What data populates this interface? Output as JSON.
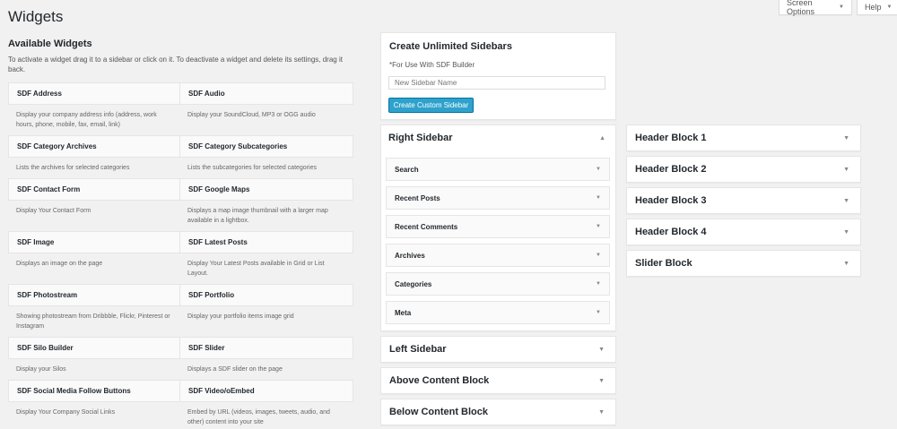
{
  "page_title": "Widgets",
  "screen_options": {
    "label": "Screen Options",
    "icon": "caret-down-icon"
  },
  "help": {
    "label": "Help",
    "icon": "caret-down-icon"
  },
  "available": {
    "heading": "Available Widgets",
    "description": "To activate a widget drag it to a sidebar or click on it. To deactivate a widget and delete its settings, drag it back.",
    "widgets": [
      {
        "name": "SDF Address",
        "desc": "Display your company address info (address, work hours, phone, mobile, fax, email, link)"
      },
      {
        "name": "SDF Audio",
        "desc": "Display your SoundCloud, MP3 or OGG audio"
      },
      {
        "name": "SDF Category Archives",
        "desc": "Lists the archives for selected categories"
      },
      {
        "name": "SDF Category Subcategories",
        "desc": "Lists the subcategories for selected categories"
      },
      {
        "name": "SDF Contact Form",
        "desc": "Display Your Contact Form"
      },
      {
        "name": "SDF Google Maps",
        "desc": "Displays a map image thumbnail with a larger map available in a lightbox."
      },
      {
        "name": "SDF Image",
        "desc": "Displays an image on the page"
      },
      {
        "name": "SDF Latest Posts",
        "desc": "Display Your Latest Posts available in Grid or List Layout."
      },
      {
        "name": "SDF Photostream",
        "desc": "Showing photostream from Dribbble, Flickr, Pinterest or Instagram"
      },
      {
        "name": "SDF Portfolio",
        "desc": "Display your portfolio items image grid"
      },
      {
        "name": "SDF Silo Builder",
        "desc": "Display your Silos"
      },
      {
        "name": "SDF Slider",
        "desc": "Displays a SDF slider on the page"
      },
      {
        "name": "SDF Social Media Follow Buttons",
        "desc": "Display Your Company Social Links"
      },
      {
        "name": "SDF Video/oEmbed",
        "desc": "Embed by URL (videos, images, tweets, audio, and other) content into your site"
      }
    ]
  },
  "create_sidebar": {
    "title": "Create Unlimited Sidebars",
    "note": "*For Use With SDF Builder",
    "input_placeholder": "New Sidebar Name",
    "button_label": "Create Custom Sidebar"
  },
  "right_sidebar": {
    "title": "Right Sidebar",
    "widgets": [
      "Search",
      "Recent Posts",
      "Recent Comments",
      "Archives",
      "Categories",
      "Meta"
    ]
  },
  "middle_sidebars": [
    "Left Sidebar",
    "Above Content Block",
    "Below Content Block"
  ],
  "right_column_sidebars": [
    "Header Block 1",
    "Header Block 2",
    "Header Block 3",
    "Header Block 4",
    "Slider Block"
  ],
  "arrow_glyphs": {
    "down": "▼",
    "up": "▲"
  }
}
